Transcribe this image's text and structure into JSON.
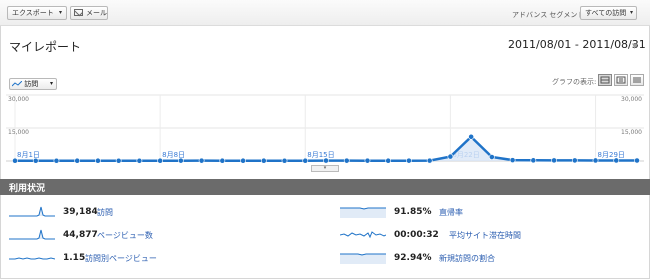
{
  "toolbar": {
    "export_label": "エクスポート",
    "mail_label": "メール",
    "advanced_segment_label": "アドバンス セグメント",
    "segment_select_label": "すべての訪問"
  },
  "page": {
    "title": "マイレポート",
    "date_range": "2011/08/01 - 2011/08/31"
  },
  "chart_controls": {
    "metric_select_label": "訪問",
    "graph_display_label": "グラフの表示:"
  },
  "chart_data": {
    "type": "line",
    "title": "",
    "y_left_ticks": [
      "30,000",
      "15,000"
    ],
    "y_right_ticks": [
      "30,000",
      "15,000"
    ],
    "ylim": [
      0,
      30000
    ],
    "x_tick_labels": [
      "8月1日",
      "8月8日",
      "8月15日",
      "8月22日",
      "8月29日"
    ],
    "x_tick_days": [
      1,
      8,
      15,
      22,
      29
    ],
    "series": [
      {
        "name": "",
        "color": "#1f73c8",
        "x": [
          1,
          2,
          3,
          4,
          5,
          6,
          7,
          8,
          9,
          10,
          11,
          12,
          13,
          14,
          15,
          16,
          17,
          18,
          19,
          20,
          21,
          22,
          23,
          24,
          25,
          26,
          27,
          28,
          29,
          30,
          31
        ],
        "values": [
          120,
          110,
          115,
          130,
          120,
          110,
          100,
          140,
          150,
          160,
          140,
          130,
          120,
          110,
          130,
          180,
          160,
          150,
          140,
          150,
          170,
          2000,
          11000,
          1800,
          400,
          300,
          280,
          260,
          250,
          240,
          230
        ]
      }
    ]
  },
  "usage": {
    "title": "利用状況",
    "metrics": [
      {
        "value": "39,184",
        "label": "訪問"
      },
      {
        "value": "44,877",
        "label": "ページビュー数"
      },
      {
        "value": "1.15",
        "label": "訪問別ページビュー"
      },
      {
        "value": "91.85%",
        "label": "直帰率"
      },
      {
        "value": "00:00:32",
        "label": "平均サイト滞在時間"
      },
      {
        "value": "92.94%",
        "label": "新規訪問の割合"
      }
    ]
  }
}
